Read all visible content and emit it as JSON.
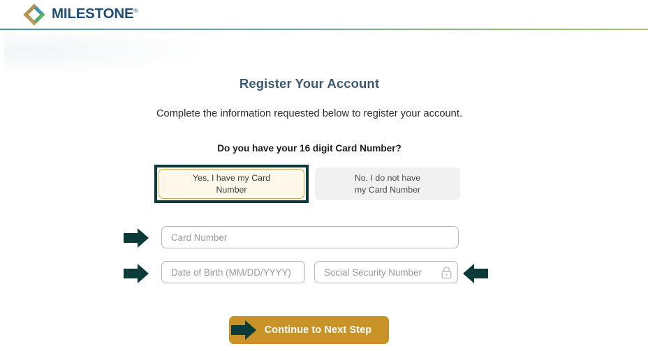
{
  "header": {
    "brand_name": "MILESTONE",
    "brand_trademark": "®",
    "logo_icon": "diamond-logo-icon",
    "rule_gradient_start": "#4a8fa8",
    "rule_gradient_end": "#a8c96a"
  },
  "main": {
    "title": "Register Your Account",
    "subtitle": "Complete the information requested below to register your account.",
    "question": "Do you have your 16 digit Card Number?"
  },
  "choices": {
    "yes": {
      "line1": "Yes, I have my Card",
      "line2": "Number",
      "selected": true,
      "fill_color": "#fdf8ea",
      "border_color": "#c8a84f",
      "focus_ring_color": "#0b3b38"
    },
    "no": {
      "line1": "No, I do not have",
      "line2": "my Card Number",
      "selected": false,
      "fill_color": "#f1f1f1"
    }
  },
  "form": {
    "card_number": {
      "placeholder": "Card Number",
      "value": "",
      "arrow_icon": "arrow-right-icon"
    },
    "date_of_birth": {
      "placeholder": "Date of Birth (MM/DD/YYYY)",
      "value": "",
      "arrow_icon": "arrow-right-icon"
    },
    "social_security_number": {
      "placeholder": "Social Security Number",
      "value": "",
      "lock_icon": "lock-icon",
      "arrow_icon": "arrow-left-icon"
    }
  },
  "actions": {
    "continue": {
      "label": "Continue to Next Step",
      "arrow_icon": "arrow-right-icon",
      "background_color": "#c89226",
      "text_color": "#ffffff"
    }
  },
  "colors": {
    "brand_navy": "#1f4e79",
    "title_slate": "#3c5a73",
    "arrow_teal": "#0b3b38",
    "gold": "#c89226"
  }
}
